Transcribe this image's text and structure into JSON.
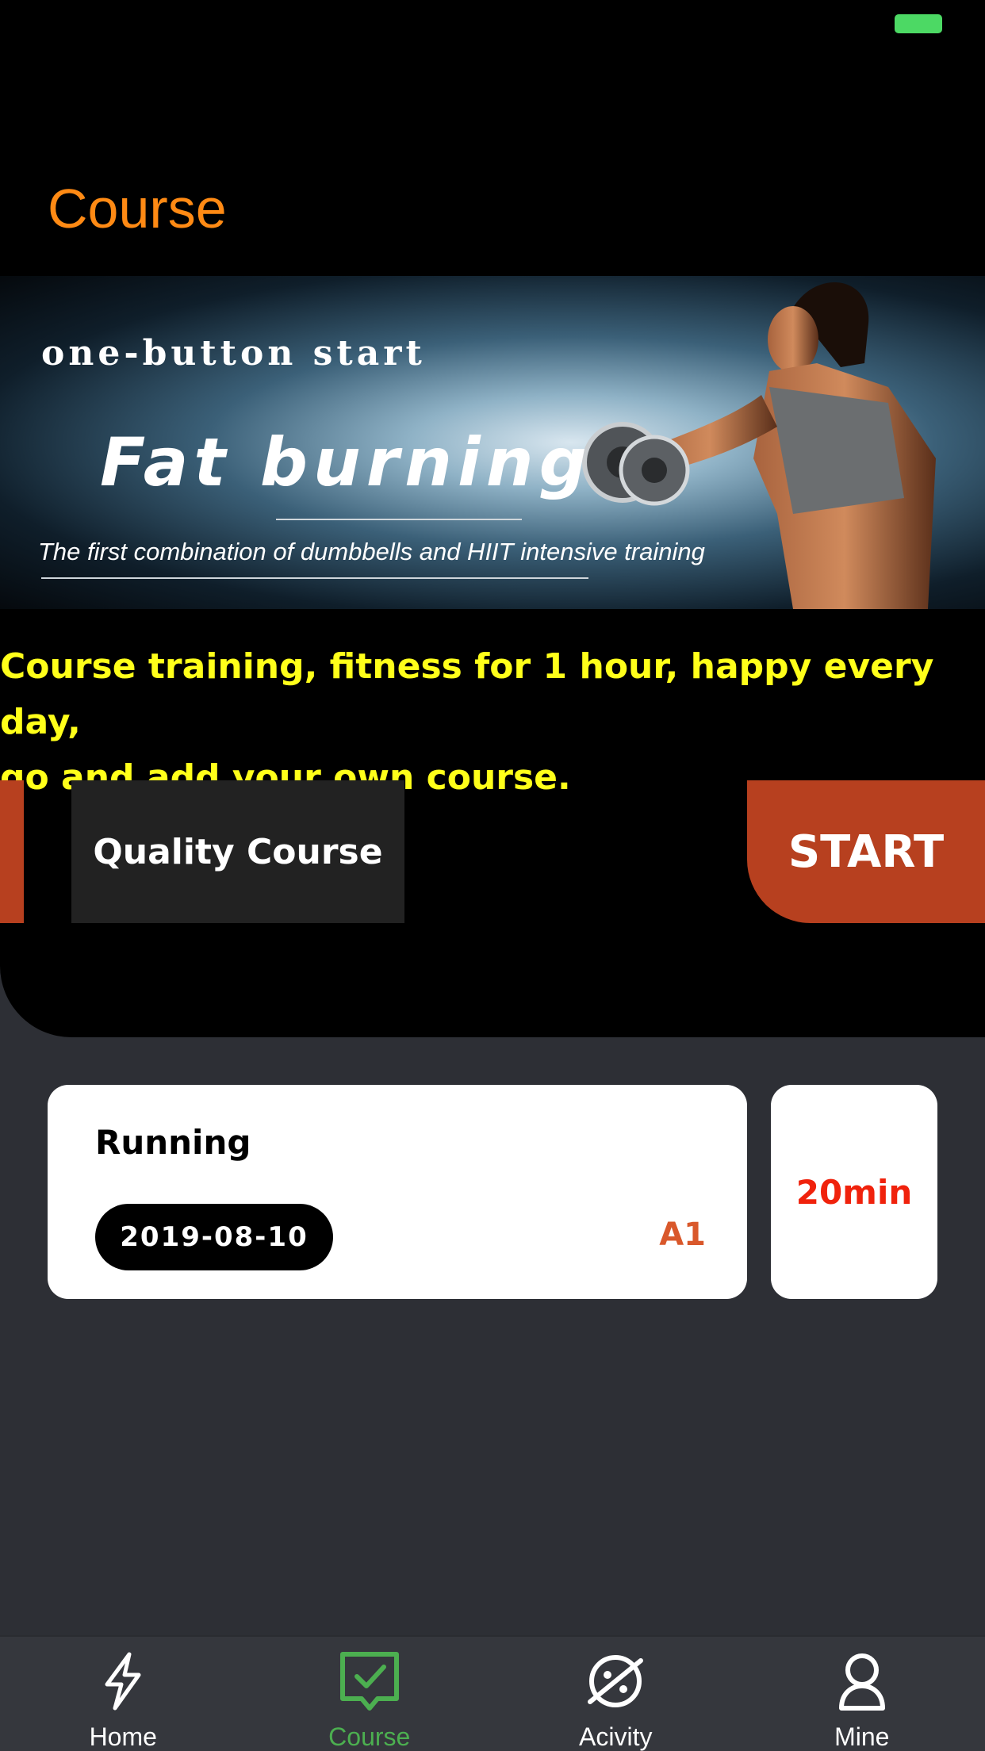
{
  "header": {
    "title": "Course"
  },
  "banner": {
    "line1": "one-button start",
    "line2": "Fat burning",
    "line3": "The first combination of dumbbells and HIIT intensive training"
  },
  "promo": {
    "line1": "Course training, fitness for 1 hour, happy every day,",
    "line2": "go and add your own course."
  },
  "actions": {
    "quality_label": "Quality Course",
    "start_label": "START"
  },
  "course": {
    "name": "Running",
    "date": "2019-08-10",
    "level": "A1",
    "duration": "20min"
  },
  "tabbar": {
    "items": [
      {
        "label": "Home",
        "icon": "lightning-icon"
      },
      {
        "label": "Course",
        "icon": "checklist-icon"
      },
      {
        "label": "Acivity",
        "icon": "planet-icon"
      },
      {
        "label": "Mine",
        "icon": "person-icon"
      }
    ],
    "active": "Course"
  },
  "colors": {
    "accent": "#ff8a14",
    "start": "#b7401f",
    "promo": "#ffff1a",
    "active_tab": "#4caf50"
  }
}
